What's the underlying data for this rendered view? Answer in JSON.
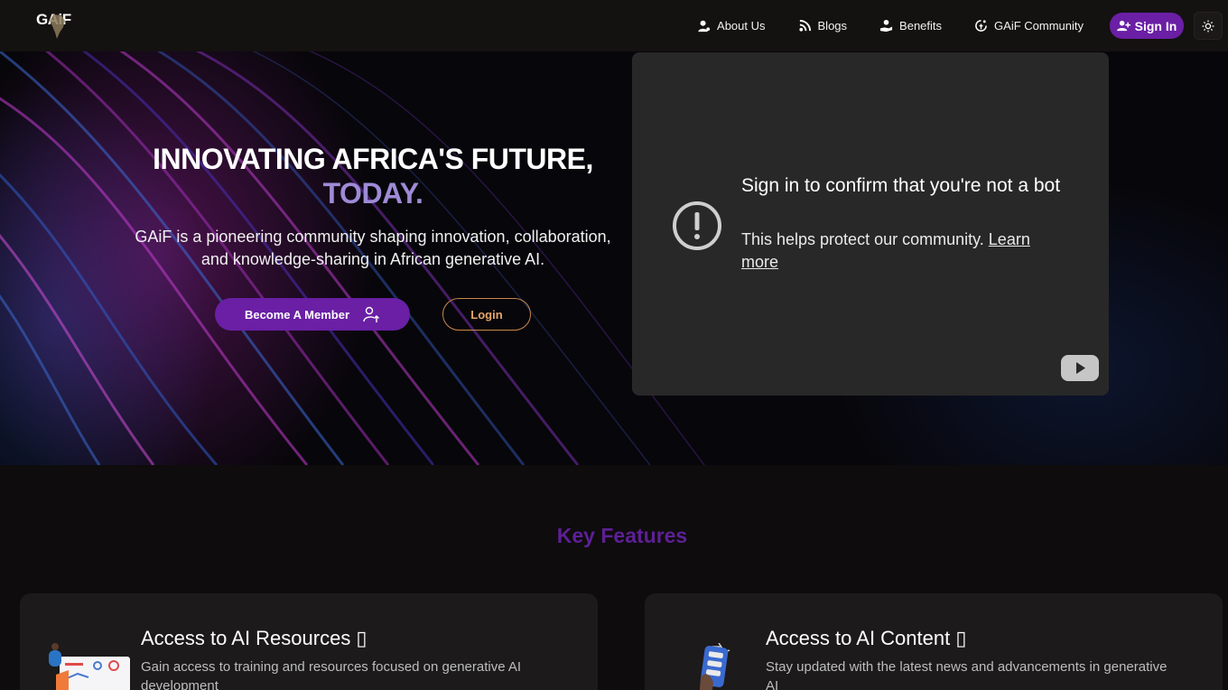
{
  "nav": {
    "logo_text": "GAiF",
    "items": [
      {
        "label": "About Us",
        "icon": "user-icon"
      },
      {
        "label": "Blogs",
        "icon": "rss-icon"
      },
      {
        "label": "Benefits",
        "icon": "hand-coin-icon"
      },
      {
        "label": "GAiF Community",
        "icon": "community-icon"
      }
    ],
    "sign_in_label": "Sign In",
    "theme_toggle_icon": "sun-icon"
  },
  "hero": {
    "title_line1": "INNOVATING AFRICA'S FUTURE,",
    "title_line2": "TODAY.",
    "subtitle": "GAiF is a pioneering community shaping innovation, collaboration, and knowledge-sharing in African generative AI.",
    "member_button": "Become A Member",
    "login_button": "Login"
  },
  "video": {
    "title": "Sign in to confirm that you're not a bot",
    "message": "This helps protect our community.",
    "link": "Learn more"
  },
  "features": {
    "title": "Key Features",
    "cards": [
      {
        "title": "Access to AI Resources ▯",
        "desc": "Gain access to training and resources focused on generative AI development"
      },
      {
        "title": "Access to AI Content ▯",
        "desc": "Stay updated with the latest news and advancements in generative AI"
      }
    ]
  },
  "colors": {
    "brand_purple": "#6a1fa5",
    "accent_lavender": "#9e8ad6",
    "login_orange": "#e8a56a",
    "background": "#0e0c0c"
  }
}
